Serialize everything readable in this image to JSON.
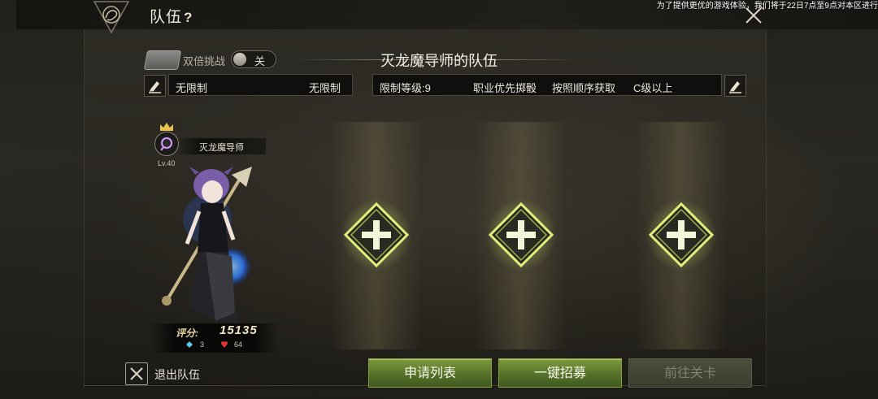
{
  "header": {
    "title": "队伍",
    "help": "?",
    "notice": "为了提供更优的游戏体验，我们将于22日7点至9点对本区进行"
  },
  "challenge": {
    "label": "双倍挑战",
    "toggle_state": "关"
  },
  "team": {
    "name": "灭龙魔导师的队伍",
    "left_field": {
      "value": "无限制",
      "right": "无限制"
    },
    "right_field": {
      "level_limit": "限制等级:9",
      "rule1": "职业优先掷骰",
      "rule2": "按照顺序获取",
      "rule3": "C级以上"
    }
  },
  "member": {
    "name": "灭龙魔导师",
    "level": "Lv.40",
    "score_label": "评分:",
    "score": "15135",
    "stat_blue": "3",
    "stat_red": "64"
  },
  "footer": {
    "exit_label": "退出队伍",
    "apply_list": "申请列表",
    "recruit": "一键招募",
    "goto_stage": "前往关卡"
  },
  "colors": {
    "accent_green": "#7e9a3c",
    "slot_glow": "#d9ef6a"
  }
}
